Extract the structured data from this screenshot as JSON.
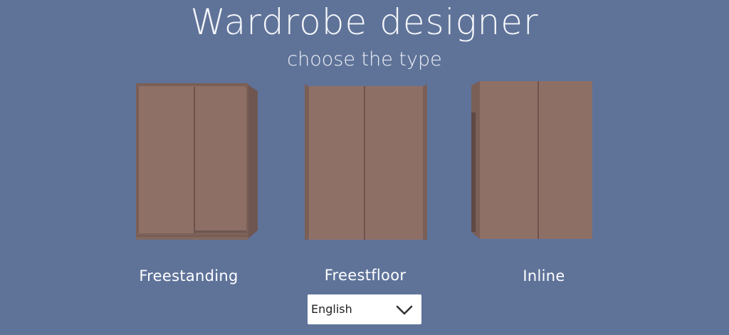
{
  "header": {
    "title": "Wardrobe designer",
    "subtitle": "choose the type"
  },
  "options": [
    {
      "label": "Freestanding"
    },
    {
      "label": "Freestfloor"
    },
    {
      "label": "Inline"
    }
  ],
  "language_select": {
    "selected": "English",
    "icon": "chevron-down-icon"
  },
  "colors": {
    "background": "#5f7399",
    "wardrobe": "#8c6e64"
  }
}
